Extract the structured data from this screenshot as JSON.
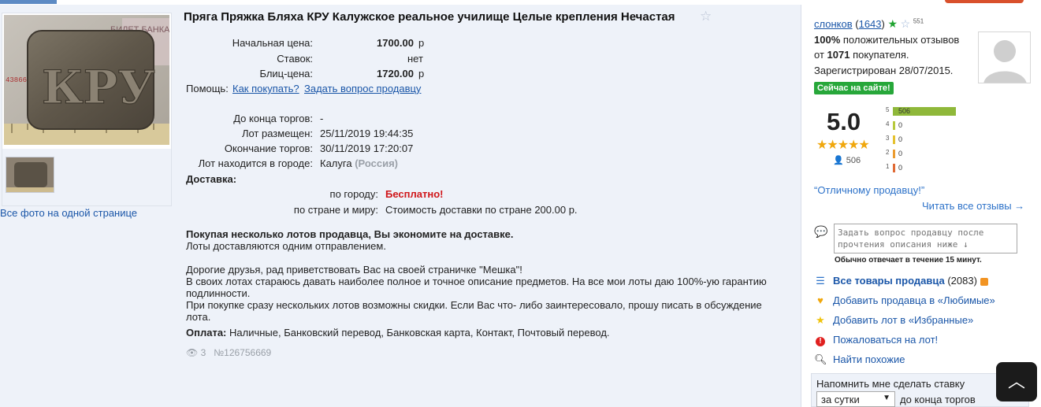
{
  "lot": {
    "title": "Пряга Пряжка Бляха КРУ Калужское реальное училище Целые крепления Нечастая",
    "start_price_label": "Начальная цена:",
    "start_price": "1700.00",
    "currency": "р",
    "bids_label": "Ставок:",
    "bids": "нет",
    "blitz_label": "Блиц-цена:",
    "blitz_price": "1720.00",
    "help_label": "Помощь:",
    "help_how": "Как покупать?",
    "help_ask": "Задать вопрос продавцу",
    "ends_in_label": "До конца торгов:",
    "ends_in": "-",
    "placed_label": "Лот размещен:",
    "placed": "25/11/2019 19:44:35",
    "end_label": "Окончание торгов:",
    "end": "30/11/2019 17:20:07",
    "city_label": "Лот находится в городе:",
    "city": "Калуга",
    "country": "(Россия)",
    "delivery_label": "Доставка:",
    "by_city_label": "по городу:",
    "by_city": "Бесплатно!",
    "by_country_label": "по стране и миру:",
    "by_country": "Стоимость доставки по стране 200.00 р.",
    "save_bold": "Покупая несколько лотов продавца, Вы экономите на доставке.",
    "save_line": "Лоты доставляются одним отправлением.",
    "desc_1": "Дорогие друзья, рад приветствовать Вас на своей страничке \"Мешка\"!",
    "desc_2": "В своих лотах стараюсь давать наиболее полное и точное описание предметов. На все мои лоты даю 100%-ую гарантию подлинности.",
    "desc_3": "При покупке сразу нескольких лотов возможны скидки. Если Вас что- либо заинтересовало, прошу писать в обсуждение лота.",
    "payment_label": "Оплата:",
    "payment": "Наличные, Банковский перевод, Банковская карта, Контакт, Почтовый перевод.",
    "views": "3",
    "lot_number": "№126756669",
    "all_photos": "Все фото на одной странице",
    "photo_text_1": "БИЛЕТ БАНКА",
    "photo_text_2": "43866",
    "photo_monogram": "КРУ"
  },
  "seller": {
    "name": "слонков",
    "rating_count": "1643",
    "badge_count": "551",
    "positive_pct": "100%",
    "positive_text": "положительных отзывов",
    "from_label": "от",
    "buyers": "1071",
    "buyers_label": "покупателя.",
    "registered": "Зарегистрирован 28/07/2015.",
    "online": "Сейчас на сайте!",
    "score": "5.0",
    "stars": "★★★★★",
    "reviews": "506",
    "histogram": [
      {
        "star": "5",
        "count": "506",
        "fraction": 1.0,
        "color": "#8fb83a"
      },
      {
        "star": "4",
        "count": "0",
        "fraction": 0,
        "color": "#b7c93c"
      },
      {
        "star": "3",
        "count": "0",
        "fraction": 0,
        "color": "#e5c12e"
      },
      {
        "star": "2",
        "count": "0",
        "fraction": 0,
        "color": "#eb9b2f"
      },
      {
        "star": "1",
        "count": "0",
        "fraction": 0,
        "color": "#e06a35"
      }
    ],
    "quote": "“Отличному продавцу!”",
    "read_all": "Читать все отзывы →",
    "ask_placeholder": "Задать вопрос продавцу после прочтения описания ниже ↓",
    "answers": "Обычно отвечает в течение 15 минут.",
    "all_items": "Все товары продавца",
    "all_items_count": "(2083)",
    "add_fav_seller": "Добавить продавца в «Любимые»",
    "add_fav_lot": "Добавить лот в «Избранные»",
    "complain": "Пожаловаться на лот!",
    "find_similar": "Найти похожие",
    "remind_label": "Напомнить мне сделать ставку",
    "remind_option": "за сутки",
    "remind_tail": "до конца торгов"
  }
}
